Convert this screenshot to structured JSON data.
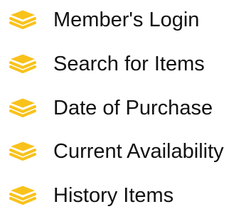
{
  "menu": {
    "accent_color": "#F9C21B",
    "items": [
      {
        "label": "Member's Login",
        "icon": "stack-layers-icon"
      },
      {
        "label": "Search for Items",
        "icon": "stack-layers-icon"
      },
      {
        "label": "Date of Purchase",
        "icon": "stack-layers-icon"
      },
      {
        "label": "Current Availability",
        "icon": "stack-layers-icon"
      },
      {
        "label": "History Items",
        "icon": "stack-layers-icon"
      }
    ]
  }
}
